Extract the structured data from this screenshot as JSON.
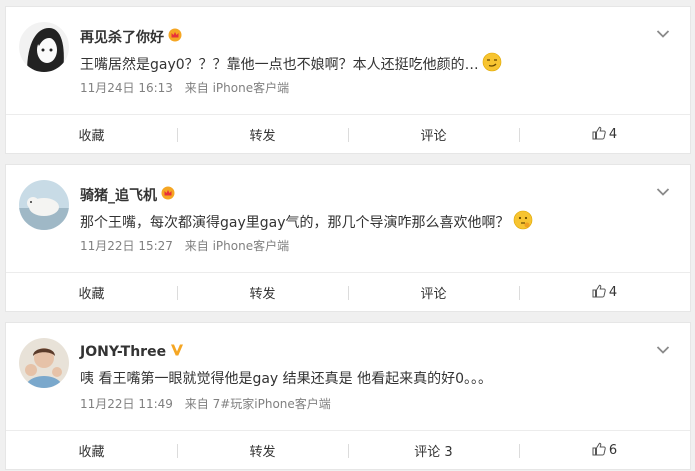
{
  "comments": [
    {
      "username": "再见杀了你好",
      "text": "王嘴居然是gay0？？？靠他一点也不娘啊？本人还挺吃他颜的…",
      "time": "11月24日 16:13",
      "source": "来自 iPhone客户端",
      "badge": "crown-badge-icon",
      "emoji": "smirk-emoji-icon",
      "actions": {
        "collect": "收藏",
        "repost": "转发",
        "comment": "评论",
        "like_count": "4"
      }
    },
    {
      "username": "骑猪_追飞机",
      "text": "那个王嘴，每次都演得gay里gay气的，那几个导演咋那么喜欢他啊？",
      "time": "11月22日 15:27",
      "source": "来自 iPhone客户端",
      "badge": "crown-badge-icon",
      "emoji": "thinking-emoji-icon",
      "actions": {
        "collect": "收藏",
        "repost": "转发",
        "comment": "评论",
        "like_count": "4"
      }
    },
    {
      "username": "JONY-Three",
      "text": "咦 看王嘴第一眼就觉得他是gay 结果还真是 他看起来真的好0。。。",
      "time": "11月22日 11:49",
      "source": "来自 7#玩家iPhone客户端",
      "badge": "verified-v-icon",
      "actions": {
        "collect": "收藏",
        "repost": "转发",
        "comment": "评论 3",
        "like_count": "6"
      }
    }
  ],
  "colors": {
    "background": "#f0f0f0",
    "text": "#333333",
    "meta": "#808080",
    "verified": "#f5a623"
  }
}
